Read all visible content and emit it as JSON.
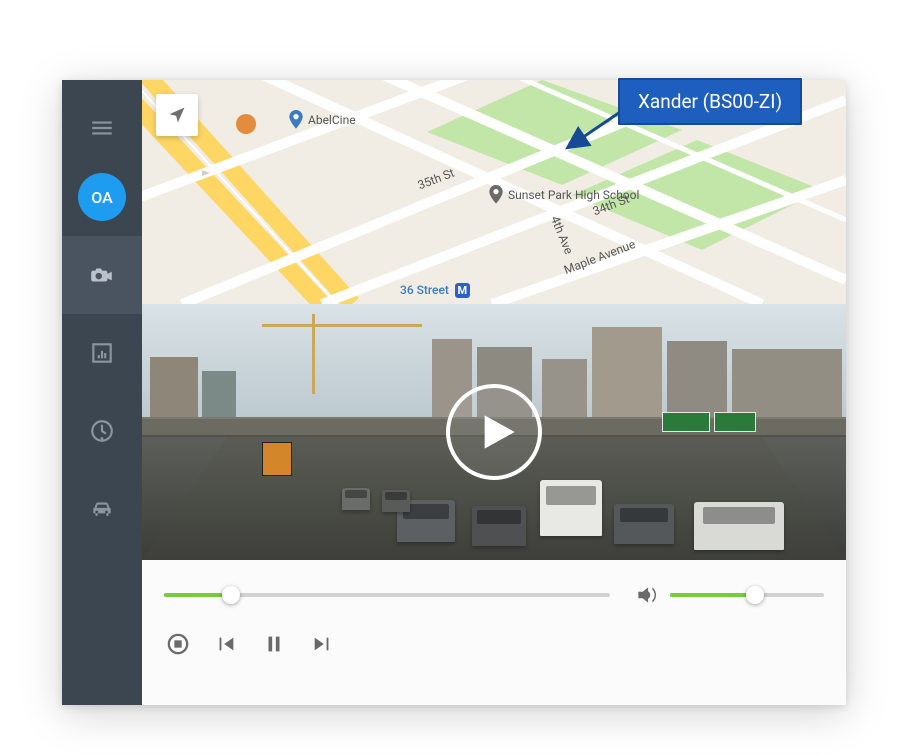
{
  "callout": {
    "label": "Xander (BS00-ZI)"
  },
  "sidebar": {
    "avatar": "OA",
    "items": [
      {
        "name": "menu"
      },
      {
        "name": "avatar"
      },
      {
        "name": "camera"
      },
      {
        "name": "stats"
      },
      {
        "name": "clock"
      },
      {
        "name": "car"
      }
    ]
  },
  "map": {
    "poi": {
      "abelcine": "AbelCine",
      "school": "Sunset Park High School",
      "street36": "36 Street",
      "subway_letter": "M",
      "street35": "35th St",
      "ave4": "4th Ave",
      "maple": "Maple Avenue",
      "street34": "34th St"
    }
  },
  "player": {
    "progress_pct": 15,
    "volume_pct": 55
  },
  "colors": {
    "sidebar_bg": "#3c4651",
    "accent_blue": "#1d9cf0",
    "callout_blue": "#1d5ebe",
    "progress_green": "#72cf3a"
  }
}
